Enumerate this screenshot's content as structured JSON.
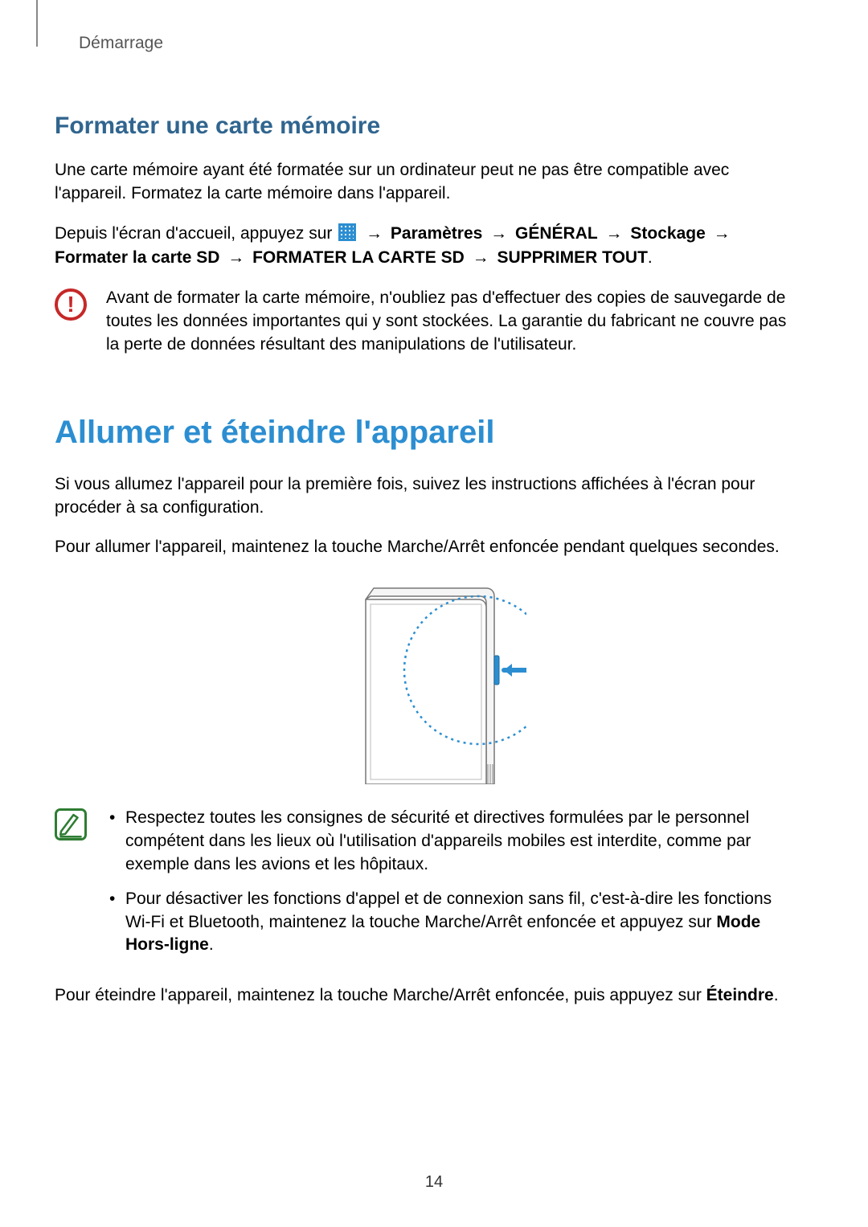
{
  "chapter": "Démarrage",
  "section1": {
    "heading": "Formater une carte mémoire",
    "para1": "Une carte mémoire ayant été formatée sur un ordinateur peut ne pas être compatible avec l'appareil. Formatez la carte mémoire dans l'appareil.",
    "path_intro": "Depuis l'écran d'accueil, appuyez sur",
    "path_arrow": "→",
    "path_p1": "Paramètres",
    "path_p2": "GÉNÉRAL",
    "path_p3": "Stockage",
    "path_p4": "Formater la carte SD",
    "path_p5": "FORMATER LA CARTE SD",
    "path_p6": "SUPPRIMER TOUT",
    "warning": "Avant de formater la carte mémoire, n'oubliez pas d'effectuer des copies de sauvegarde de toutes les données importantes qui y sont stockées. La garantie du fabricant ne couvre pas la perte de données résultant des manipulations de l'utilisateur."
  },
  "section2": {
    "heading": "Allumer et éteindre l'appareil",
    "para1": "Si vous allumez l'appareil pour la première fois, suivez les instructions affichées à l'écran pour procéder à sa configuration.",
    "para2": "Pour allumer l'appareil, maintenez la touche Marche/Arrêt enfoncée pendant quelques secondes.",
    "note_bullet1": "Respectez toutes les consignes de sécurité et directives formulées par le personnel compétent dans les lieux où l'utilisation d'appareils mobiles est interdite, comme par exemple dans les avions et les hôpitaux.",
    "note_bullet2_a": "Pour désactiver les fonctions d'appel et de connexion sans fil, c'est-à-dire les fonctions Wi-Fi et Bluetooth, maintenez la touche Marche/Arrêt enfoncée et appuyez sur ",
    "note_bullet2_b": "Mode Hors-ligne",
    "para3_a": "Pour éteindre l'appareil, maintenez la touche Marche/Arrêt enfoncée, puis appuyez sur ",
    "para3_b": "Éteindre"
  },
  "page_number": "14"
}
